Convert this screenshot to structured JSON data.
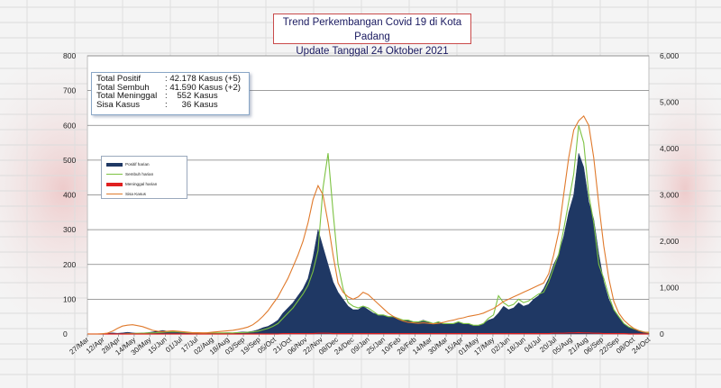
{
  "title": {
    "line1": "Trend  Perkembangan Covid  19 di Kota Padang",
    "line2": "Update Tanggal 24 Oktober  2021"
  },
  "stats": [
    {
      "label": "Total Positif",
      "value": ": 42.178 Kasus (+5)"
    },
    {
      "label": "Total Sembuh",
      "value": ": 41.590 Kasus (+2)"
    },
    {
      "label": "Total Meninggal",
      "value": ":    552 Kasus"
    },
    {
      "label": "Sisa Kasus",
      "value": ":      36 Kasus"
    }
  ],
  "colors": {
    "positif": "#1f3864",
    "sembuh": "#7cc242",
    "meninggal": "#e02020",
    "sisa": "#e07a2c",
    "title_border": "#c94a4a"
  },
  "chart_data": {
    "type": "area",
    "x_dates": [
      "27/Mar",
      "12/Apr",
      "28/Apr",
      "14/May",
      "30/May",
      "15/Jun",
      "01/Jul",
      "17/Jul",
      "02/Aug",
      "18/Aug",
      "03/Sep",
      "19/Sep",
      "05/Oct",
      "21/Oct",
      "06/Nov",
      "22/Nov",
      "08/Dec",
      "24/Dec",
      "09/Jan",
      "25/Jan",
      "10/Feb",
      "26/Feb",
      "14/Mar",
      "30/Mar",
      "15/Apr",
      "01/May",
      "17/May",
      "02/Jun",
      "18/Jun",
      "04/Jul",
      "20/Jul",
      "05/Aug",
      "21/Aug",
      "06/Sep",
      "22/Sep",
      "08/Oct",
      "24/Oct"
    ],
    "y_left_ticks": [
      "0",
      "100",
      "200",
      "300",
      "400",
      "500",
      "600",
      "700",
      "800"
    ],
    "y_right_ticks": [
      "0",
      "1,000",
      "2,000",
      "3,000",
      "4,000",
      "5,000",
      "6,000"
    ],
    "ylim_left": [
      0,
      800
    ],
    "ylim_right": [
      0,
      6000
    ],
    "grid": true,
    "legend_position": "left-middle",
    "series": [
      {
        "name": "Positif harian",
        "axis": "left",
        "values": [
          0,
          0,
          0,
          1,
          2,
          3,
          2,
          3,
          5,
          3,
          2,
          3,
          4,
          6,
          8,
          10,
          8,
          9,
          6,
          5,
          4,
          3,
          3,
          2,
          3,
          4,
          3,
          3,
          4,
          3,
          5,
          6,
          6,
          8,
          12,
          18,
          22,
          30,
          40,
          60,
          75,
          90,
          110,
          130,
          160,
          220,
          300,
          250,
          200,
          150,
          120,
          100,
          80,
          70,
          70,
          80,
          70,
          60,
          55,
          55,
          50,
          50,
          45,
          40,
          40,
          35,
          35,
          40,
          35,
          30,
          35,
          30,
          30,
          30,
          35,
          30,
          30,
          25,
          25,
          30,
          40,
          45,
          60,
          80,
          70,
          75,
          90,
          80,
          85,
          100,
          110,
          130,
          160,
          200,
          230,
          280,
          350,
          400,
          520,
          480,
          380,
          330,
          230,
          150,
          100,
          70,
          50,
          30,
          20,
          15,
          8,
          5,
          3
        ]
      },
      {
        "name": "Sembuh harian",
        "axis": "left",
        "values": [
          0,
          0,
          0,
          0,
          0,
          0,
          0,
          0,
          1,
          1,
          2,
          2,
          3,
          3,
          4,
          5,
          6,
          6,
          6,
          5,
          4,
          3,
          3,
          2,
          3,
          3,
          3,
          3,
          3,
          3,
          4,
          4,
          5,
          6,
          8,
          12,
          16,
          22,
          30,
          45,
          60,
          75,
          95,
          115,
          140,
          180,
          240,
          420,
          520,
          350,
          200,
          130,
          90,
          80,
          75,
          80,
          75,
          65,
          55,
          55,
          50,
          50,
          45,
          40,
          40,
          35,
          35,
          38,
          35,
          30,
          35,
          30,
          30,
          30,
          35,
          30,
          30,
          25,
          25,
          30,
          45,
          55,
          110,
          90,
          80,
          85,
          100,
          90,
          95,
          105,
          115,
          120,
          150,
          190,
          230,
          300,
          380,
          460,
          600,
          550,
          400,
          320,
          200,
          160,
          110,
          70,
          50,
          30,
          20,
          15,
          10,
          6,
          3
        ]
      },
      {
        "name": "Meninggal harian",
        "axis": "left",
        "values": [
          0,
          0,
          0,
          0,
          0,
          0,
          0,
          0,
          0,
          0,
          0,
          0,
          0,
          0,
          0,
          0,
          0,
          0,
          0,
          0,
          0,
          0,
          0,
          0,
          0,
          0,
          0,
          0,
          0,
          0,
          0,
          0,
          0,
          0,
          0,
          0,
          0,
          0,
          0,
          1,
          1,
          1,
          1,
          1,
          1,
          1,
          2,
          2,
          2,
          1,
          1,
          1,
          1,
          1,
          1,
          1,
          1,
          1,
          1,
          1,
          1,
          1,
          1,
          1,
          1,
          1,
          1,
          1,
          1,
          1,
          1,
          1,
          1,
          1,
          1,
          1,
          1,
          1,
          1,
          1,
          1,
          1,
          1,
          1,
          1,
          1,
          1,
          1,
          1,
          1,
          1,
          1,
          1,
          2,
          2,
          2,
          3,
          3,
          4,
          3,
          3,
          2,
          2,
          1,
          1,
          1,
          1,
          1,
          0,
          0,
          0,
          0,
          0
        ]
      },
      {
        "name": "Sisa Kasus",
        "axis": "right",
        "values": [
          0,
          0,
          0,
          5,
          20,
          60,
          120,
          170,
          190,
          200,
          180,
          160,
          120,
          80,
          60,
          50,
          60,
          70,
          60,
          50,
          40,
          30,
          30,
          25,
          30,
          40,
          50,
          60,
          70,
          80,
          100,
          120,
          150,
          200,
          280,
          380,
          500,
          650,
          800,
          1000,
          1200,
          1450,
          1700,
          2000,
          2400,
          2900,
          3200,
          3000,
          2400,
          1700,
          1100,
          900,
          800,
          750,
          800,
          900,
          850,
          750,
          650,
          550,
          450,
          380,
          320,
          280,
          250,
          240,
          230,
          240,
          230,
          220,
          230,
          250,
          280,
          300,
          330,
          350,
          380,
          400,
          420,
          450,
          500,
          550,
          620,
          700,
          750,
          800,
          850,
          900,
          950,
          1000,
          1050,
          1100,
          1300,
          1700,
          2200,
          3000,
          3800,
          4400,
          4600,
          4700,
          4500,
          3800,
          2800,
          1900,
          1200,
          700,
          450,
          300,
          200,
          120,
          70,
          40,
          36
        ]
      }
    ]
  },
  "legend": [
    {
      "label": "Positif harian"
    },
    {
      "label": "Sembuh harian"
    },
    {
      "label": "Meninggal harian"
    },
    {
      "label": "Sisa Kasus"
    }
  ]
}
